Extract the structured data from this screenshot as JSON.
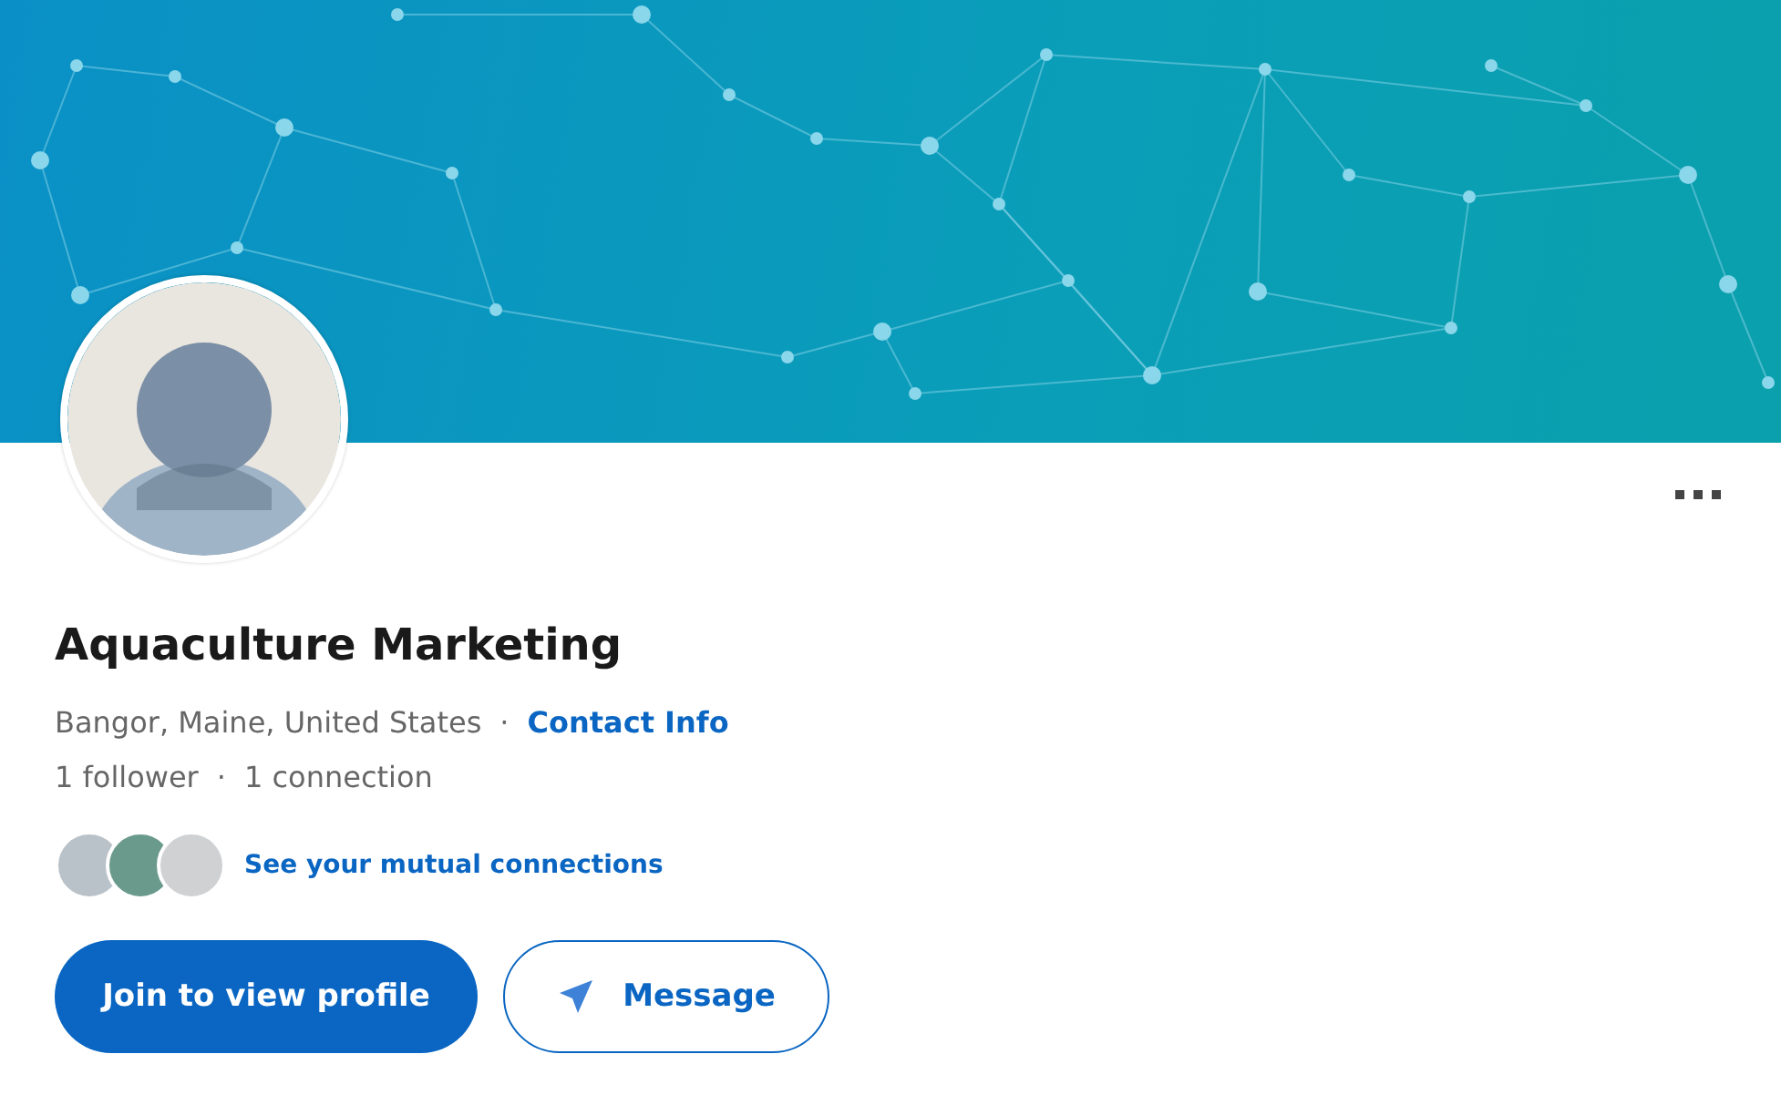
{
  "profile": {
    "name": "Aquaculture Marketing",
    "location": "Bangor, Maine, United States",
    "location_separator": "·",
    "contact_link": "Contact Info",
    "followers": "1 follower",
    "stats_separator": "·",
    "connections": "1 connection",
    "mutual_link": "See your mutual connections"
  },
  "buttons": [
    {
      "label": "Join to view profile",
      "kind": "primary"
    },
    {
      "label": "Message",
      "kind": "message"
    }
  ]
}
